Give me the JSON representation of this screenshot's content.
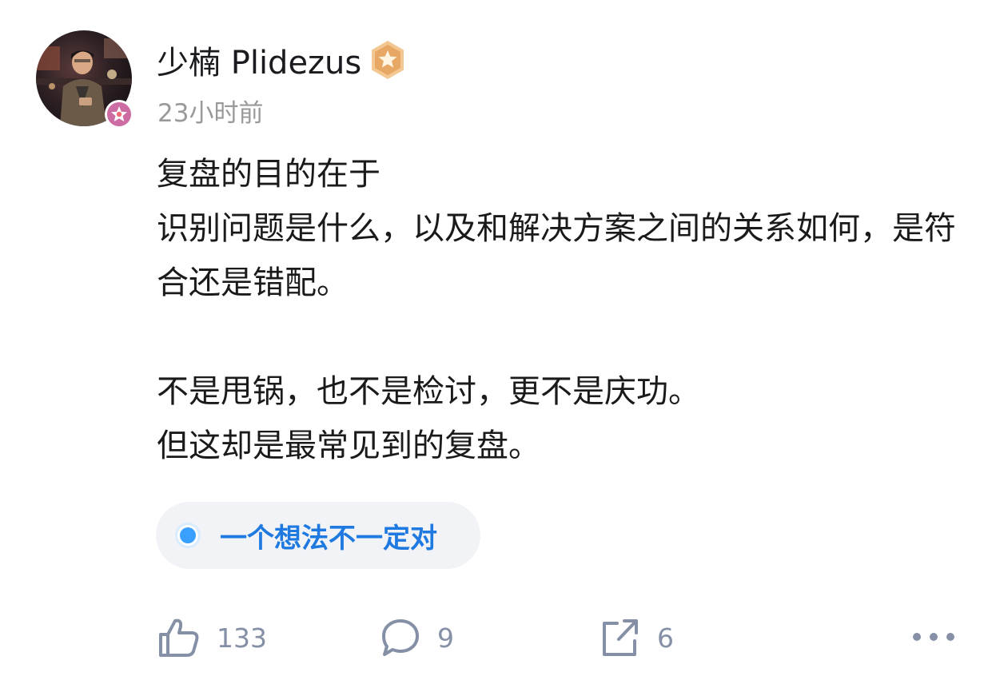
{
  "author": {
    "name": "少楠 Plidezus",
    "avatar_icon": "user-avatar-photo",
    "avatar_badge_icon": "creator-badge-icon",
    "level_badge_icon": "star-level-badge-icon"
  },
  "post": {
    "timestamp": "23小时前",
    "paragraphs": [
      "复盘的目的在于",
      "识别问题是什么，以及和解决方案之间的关系如何，是符合还是错配。",
      "",
      "不是甩锅，也不是检讨，更不是庆功。",
      "但这却是最常见到的复盘。"
    ]
  },
  "topic": {
    "label": "一个想法不一定对",
    "icon": "topic-circle-icon",
    "color": "#1e7ae0"
  },
  "actions": {
    "like_count": "133",
    "comment_count": "9",
    "share_count": "6",
    "like_icon": "thumbs-up-icon",
    "comment_icon": "comment-bubble-icon",
    "share_icon": "share-icon",
    "more_icon": "more-dots-icon"
  },
  "colors": {
    "text": "#1a1a1a",
    "muted": "#999999",
    "action": "#8590a6",
    "accent": "#1e7ae0",
    "pill_bg": "#f1f3f6"
  }
}
